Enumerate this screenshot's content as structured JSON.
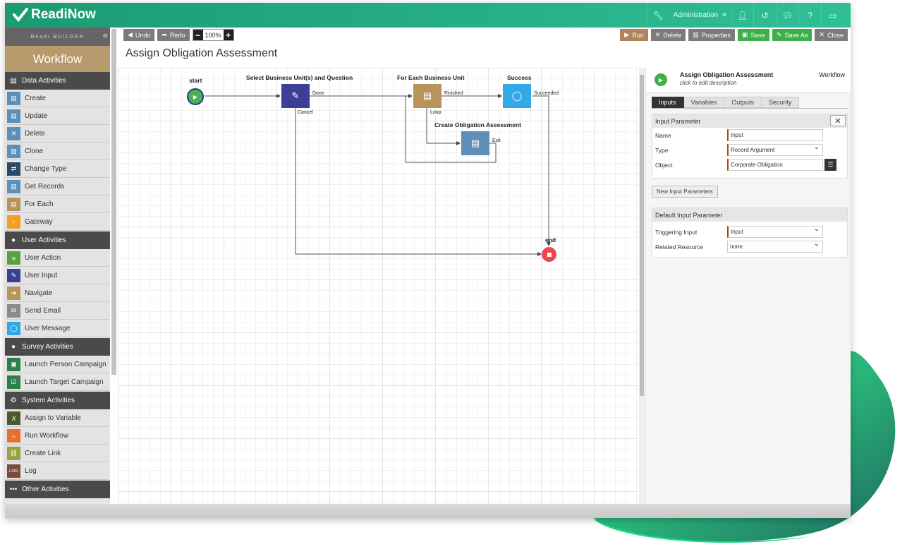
{
  "app": {
    "name": "ReadiNow"
  },
  "topbar": {
    "admin_label": "Administration"
  },
  "sidebar": {
    "builder_label": "Readi BUILDER",
    "section_title": "Workflow",
    "categories": [
      {
        "label": "Data Activities",
        "items": [
          "Create",
          "Update",
          "Delete",
          "Clone",
          "Change Type",
          "Get Records",
          "For Each",
          "Gateway"
        ]
      },
      {
        "label": "User Activities",
        "items": [
          "User Action",
          "User Input",
          "Navigate",
          "Send Email",
          "User Message"
        ]
      },
      {
        "label": "Survey Activities",
        "items": [
          "Launch Person Campaign",
          "Launch Target Campaign"
        ]
      },
      {
        "label": "System Activities",
        "items": [
          "Assign to Variable",
          "Run Workflow",
          "Create Link",
          "Log"
        ]
      },
      {
        "label": "Other Activities",
        "items": []
      }
    ]
  },
  "toolbar": {
    "undo": "Undo",
    "redo": "Redo",
    "zoom": "100%",
    "run": "Run",
    "delete": "Delete",
    "properties": "Properties",
    "save": "Save",
    "save_as": "Save As",
    "close": "Close"
  },
  "page": {
    "title": "Assign Obligation Assessment"
  },
  "diagram": {
    "start_label": "start",
    "end_label": "end",
    "nodes": {
      "select": {
        "label": "Select Business Unit(s) and Question",
        "port_out": "Done",
        "port_cancel": "Cancel"
      },
      "foreach": {
        "label": "For Each Business Unit",
        "port_finished": "Finished",
        "port_loop": "Loop"
      },
      "success": {
        "label": "Success",
        "port_out": "Succeeded"
      },
      "create": {
        "label": "Create Obligation Assessment",
        "port_exit": "Exit"
      }
    },
    "colors": {
      "select": "#3d3f97",
      "foreach": "#b7955a",
      "success": "#33a8e8",
      "create": "#5d8fb8",
      "start": "#4caf50",
      "end": "#f04848"
    }
  },
  "panel": {
    "name": "Assign Obligation Assessment",
    "description": "click to edit description",
    "type": "Workflow",
    "tabs": [
      "Inputs",
      "Variables",
      "Outputs",
      "Security"
    ],
    "input_param": {
      "title": "Input Parameter",
      "name_label": "Name",
      "name_value": "Input",
      "type_label": "Type",
      "type_value": "Record Argument",
      "object_label": "Object",
      "object_value": "Corporate Obligation"
    },
    "new_button": "New Input Parameters",
    "default_param": {
      "title": "Default Input Parameter",
      "trigger_label": "Triggering Input",
      "trigger_value": "Input",
      "related_label": "Related Resource",
      "related_value": "none"
    }
  }
}
